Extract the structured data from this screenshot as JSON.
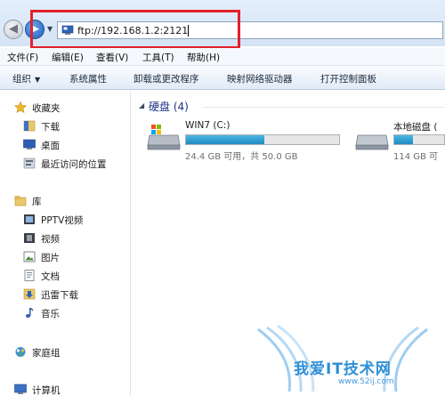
{
  "address": {
    "value": "ftp://192.168.1.2:2121"
  },
  "menu": [
    "文件(F)",
    "编辑(E)",
    "查看(V)",
    "工具(T)",
    "帮助(H)"
  ],
  "toolbar": {
    "organize": "组织",
    "system_properties": "系统属性",
    "uninstall": "卸载或更改程序",
    "map_drive": "映射网络驱动器",
    "control_panel": "打开控制面板"
  },
  "nav": {
    "favorites": "收藏夹",
    "downloads": "下载",
    "desktop": "桌面",
    "recent": "最近访问的位置",
    "libraries": "库",
    "pptv": "PPTV视频",
    "videos": "视频",
    "pictures": "图片",
    "documents": "文档",
    "thunder": "迅雷下载",
    "music": "音乐",
    "homegroup": "家庭组",
    "computer": "计算机"
  },
  "content": {
    "group_title": "硬盘 (4)",
    "drives": [
      {
        "name": "WIN7 (C:)",
        "info": "24.4 GB 可用，共 50.0 GB",
        "used_fraction": 0.51
      },
      {
        "name": "本地磁盘 (",
        "info": "114 GB 可",
        "used_fraction": 0.38
      }
    ]
  },
  "watermark": {
    "text": "我爱IT技术网",
    "url": "www.52ij.com"
  },
  "colors": {
    "highlight": "#e3202a",
    "group_title": "#1e3287",
    "drive_fill": "#1f8cc0"
  }
}
